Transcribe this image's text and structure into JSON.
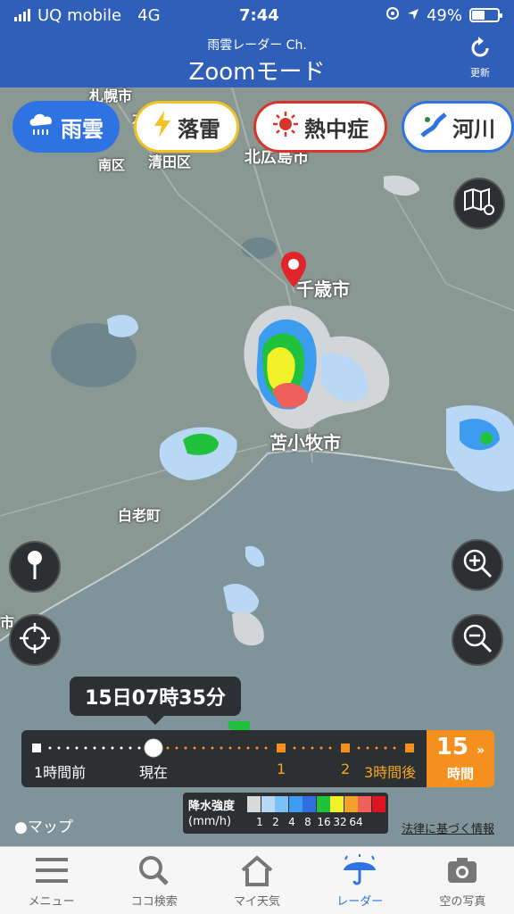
{
  "status_bar": {
    "carrier": "UQ mobile",
    "network": "4G",
    "time": "7:44",
    "battery": "49%",
    "battery_level": 0.49,
    "icons": [
      "signal-icon",
      "location-lock-icon",
      "navigation-arrow-icon",
      "battery-icon"
    ]
  },
  "header": {
    "subtitle": "雨雲レーダー Ch.",
    "title": "Zoomモード",
    "refresh_label": "更新"
  },
  "layers": [
    {
      "label": "雨雲",
      "icon": "rain-cloud-icon",
      "active": true
    },
    {
      "label": "落雷",
      "icon": "lightning-icon",
      "active": false
    },
    {
      "label": "熱中症",
      "icon": "sun-icon",
      "active": false
    },
    {
      "label": "河川",
      "icon": "river-icon",
      "active": false
    }
  ],
  "map": {
    "place_labels": {
      "sapporo": "札幌市",
      "ishikari": "石",
      "kiyota": "清田区",
      "minami": "南区",
      "kitahiroshima": "北広島市",
      "chitose": "千歳市",
      "tomakomai": "苫小牧市",
      "shiraoi": "白老町",
      "edge_city": "市"
    },
    "apple_maps": "マップ",
    "legal_link": "法律に基づく情報"
  },
  "timeline": {
    "current_time": "15日07時35分",
    "labels": {
      "past": "1時間前",
      "now": "現在",
      "plus1": "1",
      "plus2": "2",
      "plus3": "3時間後"
    },
    "hours_button": {
      "number": "15",
      "unit": "時間"
    }
  },
  "legend": {
    "title": "降水強度",
    "unit": "(mm/h)",
    "levels": [
      "1",
      "2",
      "4",
      "8",
      "16",
      "32",
      "64"
    ],
    "colors": [
      "#d9d9d9",
      "#b8d8f5",
      "#7cc1f5",
      "#3b9cf0",
      "#2e6fe0",
      "#21c23b",
      "#f2f22a",
      "#f2a12a",
      "#f0605a",
      "#e0141e"
    ]
  },
  "tabbar": [
    {
      "label": "メニュー",
      "icon": "menu-icon",
      "active": false
    },
    {
      "label": "ココ検索",
      "icon": "search-icon",
      "active": false
    },
    {
      "label": "マイ天気",
      "icon": "home-icon",
      "active": false
    },
    {
      "label": "レーダー",
      "icon": "umbrella-icon",
      "active": true
    },
    {
      "label": "空の写真",
      "icon": "camera-icon",
      "active": false
    }
  ],
  "colors": {
    "header": "#2f5fb8",
    "active_accent": "#2f73e2",
    "timeline_accent": "#f5901e"
  }
}
